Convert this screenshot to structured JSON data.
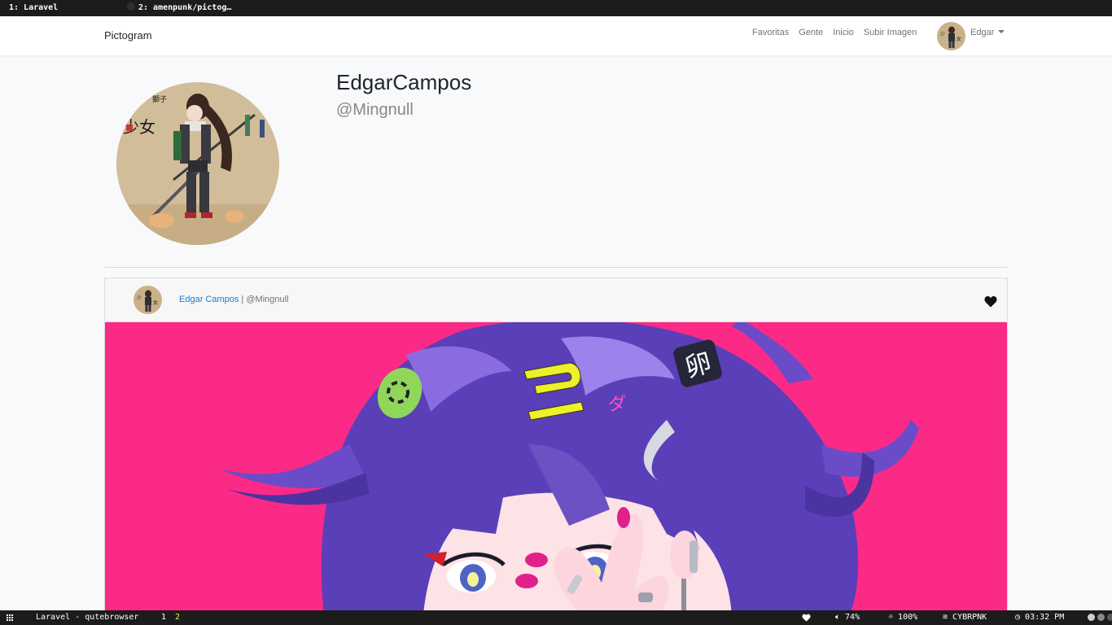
{
  "browser": {
    "tabs": [
      {
        "label": "1: Laravel"
      },
      {
        "label": "2: amenpunk/pictog…"
      }
    ]
  },
  "navbar": {
    "brand": "Pictogram",
    "links": [
      "Favoritas",
      "Gente",
      "Inicio",
      "Subir Imagen"
    ],
    "user_name": "Edgar"
  },
  "profile": {
    "name": "EdgarCampos",
    "handle": "@Mingnull"
  },
  "post": {
    "author": "Edgar Campos",
    "separator": " | ",
    "handle": "@Mingnull"
  },
  "statusbar": {
    "window_title": "Laravel - qutebrowser",
    "workspaces": [
      "1",
      "2"
    ],
    "volume": "74%",
    "brightness": "100%",
    "wifi": "CYBRPNK",
    "clock": "03:32 PM"
  },
  "colors": {
    "post_image_background": "#fb2a86",
    "link_color": "#1e7ad0",
    "active_workspace": "#f5e65a"
  },
  "icons": [
    "github-icon",
    "caret-down-icon",
    "heart-icon",
    "grid-icon",
    "volume-icon",
    "brightness-icon",
    "wifi-icon",
    "clock-icon"
  ]
}
